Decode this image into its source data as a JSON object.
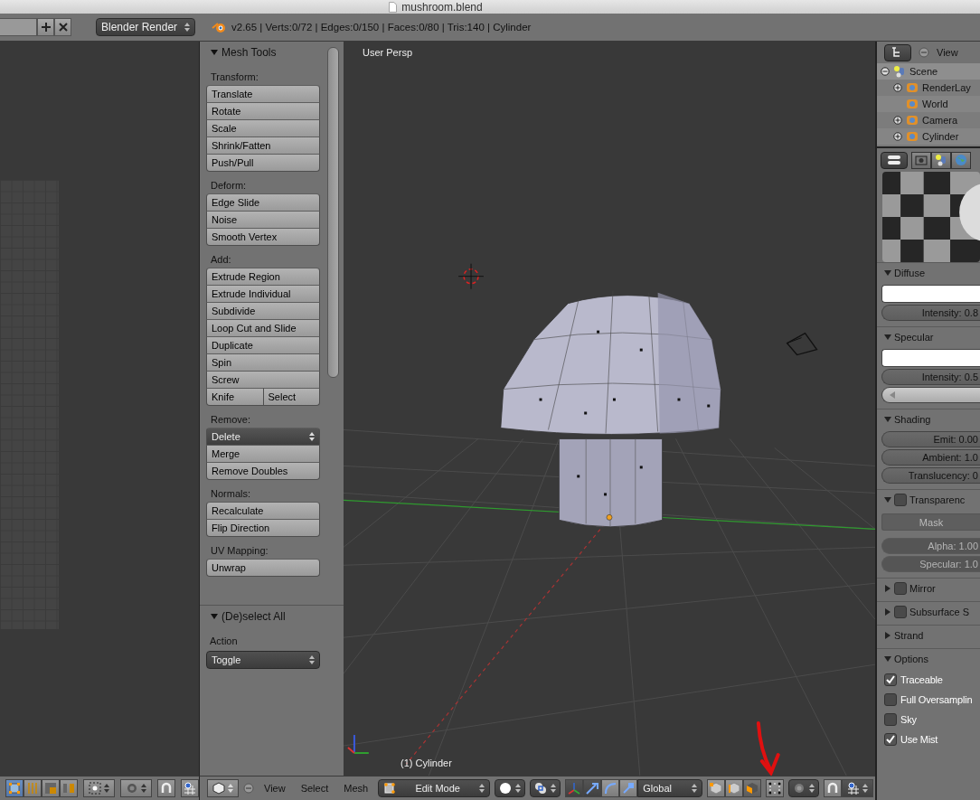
{
  "window": {
    "title": "mushroom.blend"
  },
  "info_header": {
    "render_engine": "Blender Render",
    "stats": "v2.65 | Verts:0/72 | Edges:0/150 | Faces:0/80 | Tris:140 | Cylinder"
  },
  "tool_panel": {
    "title": "Mesh Tools",
    "expanded": true,
    "groups": [
      {
        "label": "Transform:",
        "rows": [
          {
            "kind": "button",
            "label": "Translate"
          },
          {
            "kind": "button",
            "label": "Rotate"
          },
          {
            "kind": "button",
            "label": "Scale"
          },
          {
            "kind": "button",
            "label": "Shrink/Fatten"
          },
          {
            "kind": "button",
            "label": "Push/Pull"
          }
        ]
      },
      {
        "label": "Deform:",
        "rows": [
          {
            "kind": "button",
            "label": "Edge Slide"
          },
          {
            "kind": "button",
            "label": "Noise"
          },
          {
            "kind": "button",
            "label": "Smooth Vertex"
          }
        ]
      },
      {
        "label": "Add:",
        "rows": [
          {
            "kind": "button",
            "label": "Extrude Region"
          },
          {
            "kind": "button",
            "label": "Extrude Individual"
          },
          {
            "kind": "button",
            "label": "Subdivide"
          },
          {
            "kind": "button",
            "label": "Loop Cut and Slide"
          },
          {
            "kind": "button",
            "label": "Duplicate"
          },
          {
            "kind": "button",
            "label": "Spin"
          },
          {
            "kind": "button",
            "label": "Screw"
          },
          {
            "kind": "split",
            "labels": [
              "Knife",
              "Select"
            ]
          }
        ]
      },
      {
        "label": "Remove:",
        "rows": [
          {
            "kind": "dropdown",
            "label": "Delete"
          },
          {
            "kind": "button",
            "label": "Merge"
          },
          {
            "kind": "button",
            "label": "Remove Doubles"
          }
        ]
      },
      {
        "label": "Normals:",
        "rows": [
          {
            "kind": "button",
            "label": "Recalculate"
          },
          {
            "kind": "button",
            "label": "Flip Direction"
          }
        ]
      },
      {
        "label": "UV Mapping:",
        "rows": [
          {
            "kind": "button",
            "label": "Unwrap"
          }
        ]
      }
    ]
  },
  "operator_panel": {
    "title": "(De)select All",
    "expanded": true,
    "label": "Action",
    "value": "Toggle"
  },
  "viewport": {
    "view_name": "User Persp",
    "object_label": "(1) Cylinder"
  },
  "viewport_header": {
    "menus": [
      "View",
      "Select",
      "Mesh"
    ],
    "mode": "Edit Mode",
    "orientation": "Global"
  },
  "outliner": {
    "menu": "View",
    "items": [
      {
        "label": "Scene",
        "expanded": true,
        "children": [
          {
            "label": "RenderLay",
            "expanded": false
          },
          {
            "label": "World"
          },
          {
            "label": "Camera",
            "expanded": false
          },
          {
            "label": "Cylinder",
            "expanded": false
          }
        ]
      }
    ]
  },
  "properties": {
    "panels": [
      {
        "title": "Diffuse",
        "expanded": true,
        "rows": [
          {
            "kind": "swatch"
          },
          {
            "kind": "field",
            "label": "Intensity: 0.8",
            "disabled": false
          }
        ]
      },
      {
        "title": "Specular",
        "expanded": true,
        "rows": [
          {
            "kind": "swatch"
          },
          {
            "kind": "field",
            "label": "Intensity: 0.5",
            "disabled": false
          },
          {
            "kind": "slider"
          }
        ]
      },
      {
        "title": "Shading",
        "expanded": true,
        "rows": [
          {
            "kind": "field",
            "label": "Emit: 0.00",
            "disabled": false
          },
          {
            "kind": "field",
            "label": "Ambient: 1.0",
            "disabled": false
          },
          {
            "kind": "field",
            "label": "Translucency: 0",
            "disabled": false
          }
        ]
      },
      {
        "title": "Transparenc",
        "expanded": true,
        "checked": false,
        "rows": [
          {
            "kind": "button",
            "label": "Mask"
          },
          {
            "kind": "field",
            "label": "Alpha: 1.00",
            "disabled": true
          },
          {
            "kind": "field",
            "label": "Specular: 1.0",
            "disabled": true
          }
        ]
      },
      {
        "title": "Mirror",
        "expanded": false,
        "checked": false
      },
      {
        "title": "Subsurface S",
        "expanded": false,
        "checked": false
      },
      {
        "title": "Strand",
        "expanded": false
      },
      {
        "title": "Options",
        "expanded": true,
        "rows": [
          {
            "kind": "check",
            "label": "Traceable",
            "checked": true
          },
          {
            "kind": "check",
            "label": "Full Oversamplin",
            "checked": false
          },
          {
            "kind": "check",
            "label": "Sky",
            "checked": false
          },
          {
            "kind": "check",
            "label": "Use Mist",
            "checked": true
          }
        ]
      }
    ]
  }
}
